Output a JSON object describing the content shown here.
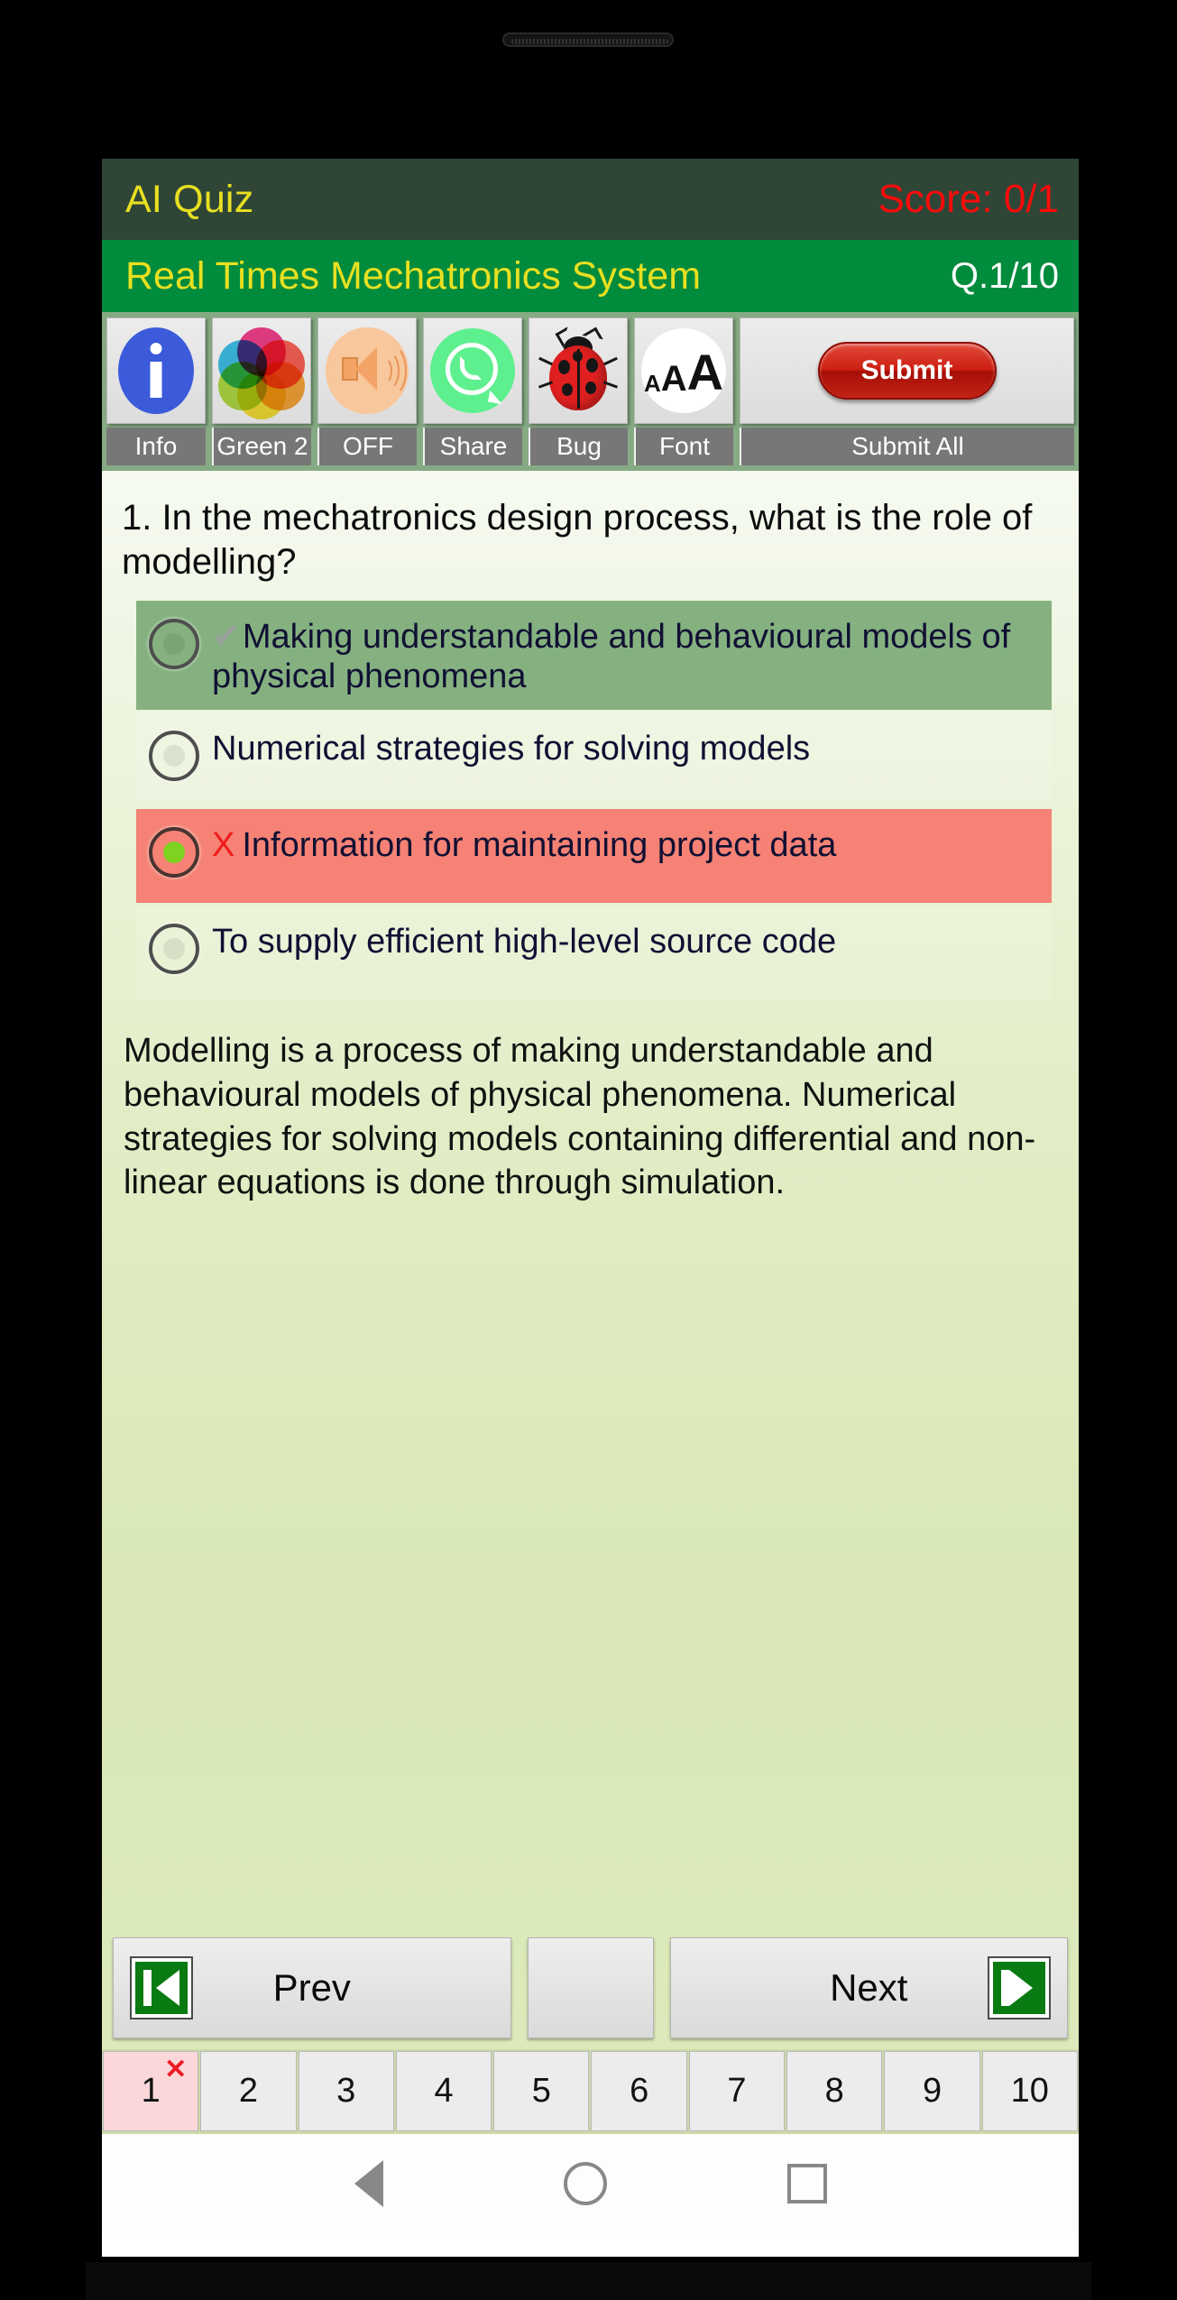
{
  "app": {
    "title": "AI Quiz",
    "score_label": "Score: 0/1",
    "subject": "Real Times Mechatronics System",
    "question_counter": "Q.1/10"
  },
  "toolbar": {
    "items": [
      {
        "label": "Info",
        "icon": "info-icon"
      },
      {
        "label": "Green 2",
        "icon": "color-palette-icon"
      },
      {
        "label": "OFF",
        "icon": "speaker-mute-icon"
      },
      {
        "label": "Share",
        "icon": "whatsapp-share-icon"
      },
      {
        "label": "Bug",
        "icon": "ladybug-icon"
      },
      {
        "label": "Font",
        "icon": "font-size-icon"
      }
    ],
    "submit_button": "Submit",
    "submit_label": "Submit All"
  },
  "question": {
    "text": "1. In the mechatronics design process, what is the role of modelling?",
    "options": [
      {
        "text": "Making understandable and behavioural models of physical phenomena",
        "state": "correct",
        "marker": "check",
        "selected": false
      },
      {
        "text": "Numerical strategies for solving models",
        "state": "plain",
        "marker": "",
        "selected": false
      },
      {
        "text": "Information for maintaining project data",
        "state": "wrong",
        "marker": "x",
        "selected": true
      },
      {
        "text": "To supply efficient high-level source code",
        "state": "plain",
        "marker": "",
        "selected": false
      }
    ],
    "explanation": "Modelling is a process of making understandable and behavioural models of physical phenomena. Numerical strategies for solving models containing differential and non-linear equations is done through simulation."
  },
  "nav": {
    "prev_label": "Prev",
    "next_label": "Next",
    "favourite_icon": "heart-icon"
  },
  "pagination": {
    "pages": [
      {
        "number": "1",
        "status": "wrong",
        "current": true
      },
      {
        "number": "2",
        "status": "",
        "current": false
      },
      {
        "number": "3",
        "status": "",
        "current": false
      },
      {
        "number": "4",
        "status": "",
        "current": false
      },
      {
        "number": "5",
        "status": "",
        "current": false
      },
      {
        "number": "6",
        "status": "",
        "current": false
      },
      {
        "number": "7",
        "status": "",
        "current": false
      },
      {
        "number": "8",
        "status": "",
        "current": false
      },
      {
        "number": "9",
        "status": "",
        "current": false
      },
      {
        "number": "10",
        "status": "",
        "current": false
      }
    ],
    "wrong_badge": "✕"
  },
  "system_nav": {
    "back": "back-icon",
    "home": "home-icon",
    "recents": "recents-icon"
  },
  "colors": {
    "title_bar": "#2f4637",
    "subject_bar": "#018b3c",
    "title_text": "#e8e021",
    "score_text": "#fb0b0b",
    "toolbar_bg": "#86ab84",
    "correct_option": "#85b180",
    "wrong_option": "#f58274",
    "submit_red": "#cc1f12",
    "radio_fill": "#7ed321"
  }
}
